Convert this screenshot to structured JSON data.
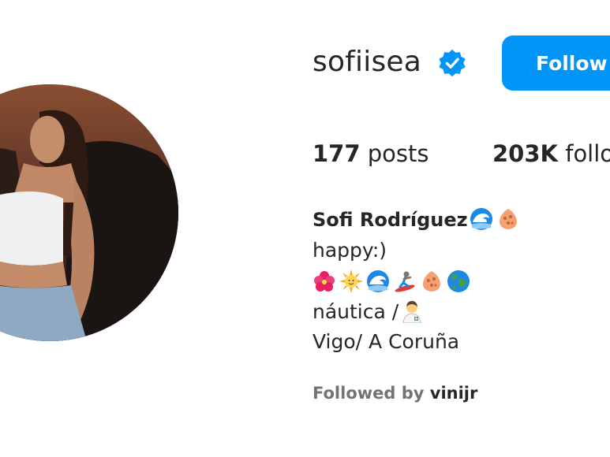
{
  "profile": {
    "username": "sofiisea",
    "verified_icon": "verified-badge-icon",
    "follow_label": "Follow",
    "posts_count": "177",
    "posts_label": "posts",
    "followers_count": "203K",
    "followers_label": "follo",
    "full_name": "Sofi Rodríguez",
    "bio": {
      "line1": "happy:)",
      "line3_text": "náutica /",
      "line4": "Vigo/ A Coruña"
    },
    "followed_by_label": "Followed by",
    "followed_by_user": "vinijr",
    "name_emojis": [
      "wave-icon",
      "shell-icon"
    ],
    "bio_emojis": [
      "hibiscus-icon",
      "sun-icon",
      "wave-icon",
      "surfer-icon",
      "shell-icon",
      "globe-icon"
    ],
    "line3_emoji": "health-worker-icon"
  },
  "colors": {
    "accent": "#0095f6",
    "text": "#262626",
    "muted": "#737373"
  }
}
